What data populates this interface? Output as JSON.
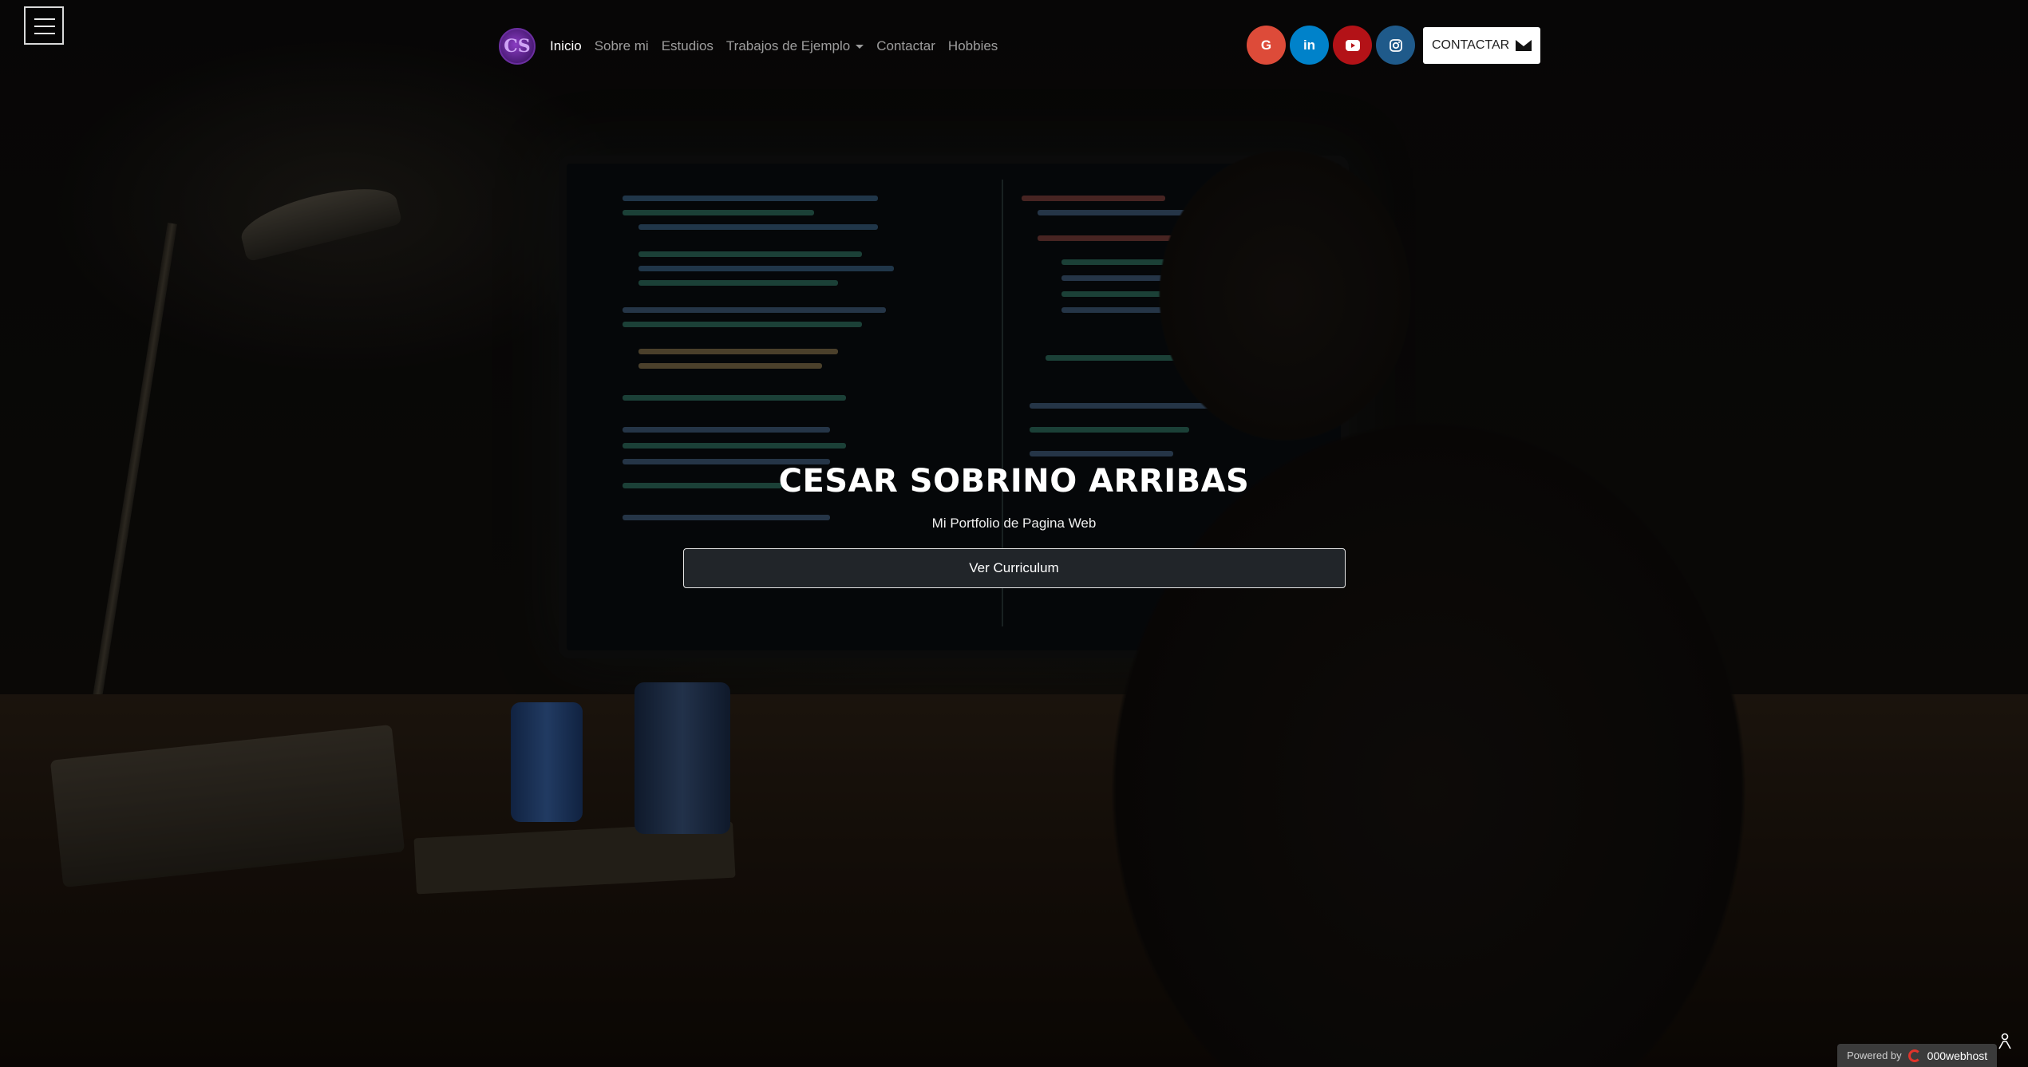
{
  "nav": {
    "logo_text": "CS",
    "links": [
      {
        "label": "Inicio",
        "active": true
      },
      {
        "label": "Sobre mi"
      },
      {
        "label": "Estudios"
      },
      {
        "label": "Trabajos de Ejemplo",
        "dropdown": true
      },
      {
        "label": "Contactar"
      },
      {
        "label": "Hobbies"
      }
    ]
  },
  "social": {
    "google": {
      "label": "G",
      "color": "#dd4b39"
    },
    "linkedin": {
      "label": "in",
      "color": "#0082ca"
    },
    "youtube": {
      "color": "#b31217"
    },
    "instagram": {
      "color": "#1f5a8a"
    },
    "contact_button": "CONTACTAR"
  },
  "hero": {
    "title": "CESAR SOBRINO ARRIBAS",
    "subtitle": "Mi Portfolio de Pagina Web",
    "button": "Ver Curriculum"
  },
  "footer": {
    "powered_by": "Powered by",
    "host": "000webhost"
  }
}
